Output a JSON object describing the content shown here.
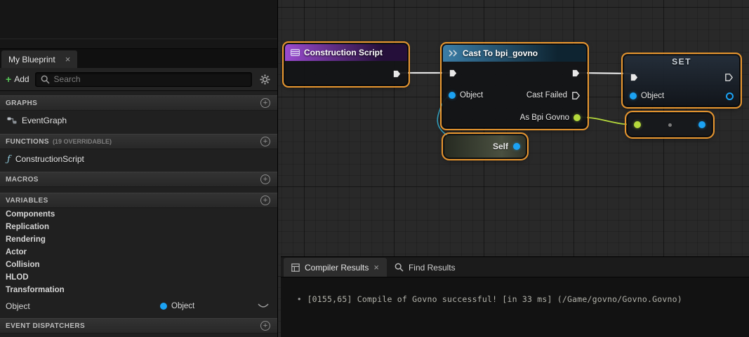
{
  "colors": {
    "accent": "#e8962e",
    "graph-bg": "#292929",
    "pin-object": "#1ba2f3",
    "pin-class": "#b5d93c",
    "exec-wire": "#e3e3e3",
    "hdr-construction-a": "#9a4bd0",
    "hdr-construction-b": "#250f3a",
    "hdr-cast-a": "#3b7ea8",
    "hdr-cast-b": "#0e2431"
  },
  "left": {
    "tab_title": "My Blueprint",
    "tab_close": "×",
    "add_label": "Add",
    "add_plus": "+",
    "search_placeholder": "Search",
    "graphs_header": "GRAPHS",
    "functions_header": "FUNCTIONS",
    "functions_note": "(19 OVERRIDABLE)",
    "macros_header": "MACROS",
    "variables_header": "VARIABLES",
    "event_dispatchers_header": "EVENT DISPATCHERS",
    "graph_items": [
      "EventGraph"
    ],
    "function_items": [
      "ConstructionScript"
    ],
    "function_icon": "ƒ",
    "variable_categories": [
      "Components",
      "Replication",
      "Rendering",
      "Actor",
      "Collision",
      "HLOD",
      "Transformation"
    ],
    "object_variable": {
      "name": "Object",
      "type": "Object"
    }
  },
  "graph": {
    "nodes": {
      "construction": {
        "title": "Construction Script"
      },
      "cast": {
        "title": "Cast To bpi_govno",
        "object_in": "Object",
        "cast_failed": "Cast Failed",
        "as_pin": "As Bpi Govno"
      },
      "self_node": {
        "label": "Self"
      },
      "set_node": {
        "title": "SET",
        "object_in": "Object"
      }
    }
  },
  "bottom": {
    "compiler_tab": "Compiler Results",
    "compiler_tab_close": "×",
    "find_tab": "Find Results",
    "log_bullet": "•",
    "log_entry": "[0155,65] Compile of Govno successful! [in 33 ms] (/Game/govno/Govno.Govno)"
  }
}
